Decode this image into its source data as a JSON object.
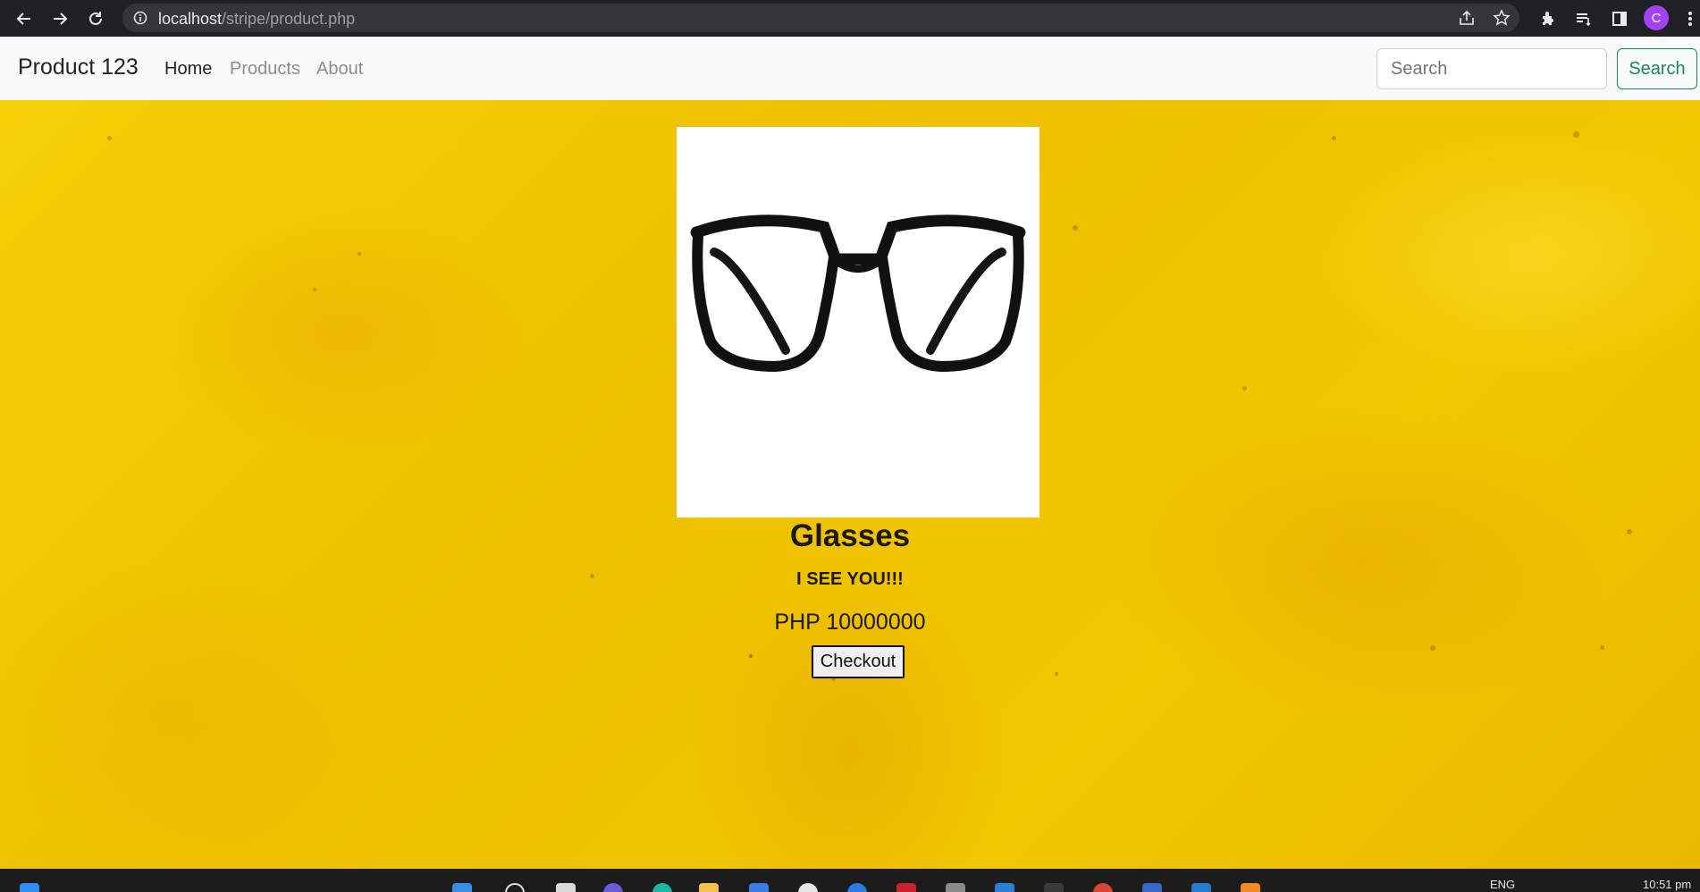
{
  "browser": {
    "url_host": "localhost",
    "url_path": "/stripe/product.php",
    "profile_initial": "C"
  },
  "navbar": {
    "brand": "Product 123",
    "links": [
      "Home",
      "Products",
      "About"
    ],
    "search_placeholder": "Search",
    "search_button": "Search"
  },
  "product": {
    "name": "Glasses",
    "tagline": "I SEE YOU!!!",
    "price": "PHP 10000000",
    "checkout_label": "Checkout"
  },
  "taskbar": {
    "language": "ENG",
    "time": "10:51 pm"
  },
  "colors": {
    "background": "#f2c700",
    "search_accent": "#198754",
    "avatar": "#a142f4"
  }
}
